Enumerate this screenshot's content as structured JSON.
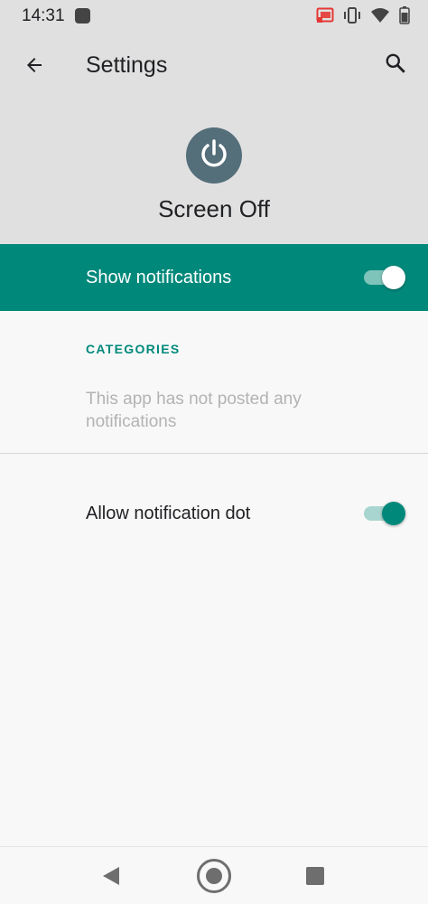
{
  "status_bar": {
    "time": "14:31",
    "icons": [
      "notification-dot-icon",
      "cast-icon",
      "vibrate-icon",
      "wifi-icon",
      "battery-icon"
    ],
    "battery_level": "82"
  },
  "app_bar": {
    "title": "Settings",
    "back_icon": "back-arrow-icon",
    "search_icon": "search-icon"
  },
  "app_header": {
    "icon": "power-icon",
    "icon_color": "#546e7a",
    "name": "Screen Off"
  },
  "master_toggle": {
    "label": "Show notifications",
    "enabled": true,
    "background_color": "#00897b"
  },
  "categories": {
    "title": "CATEGORIES",
    "empty_message": "This app has not posted any notifications"
  },
  "notification_dot": {
    "label": "Allow notification dot",
    "enabled": true
  },
  "nav_bar": {
    "buttons": [
      "back-triangle-icon",
      "home-circle-icon",
      "recents-square-icon"
    ]
  },
  "colors": {
    "accent": "#00897b",
    "header_bg": "#e0e0e0",
    "page_bg": "#f8f8f8"
  }
}
